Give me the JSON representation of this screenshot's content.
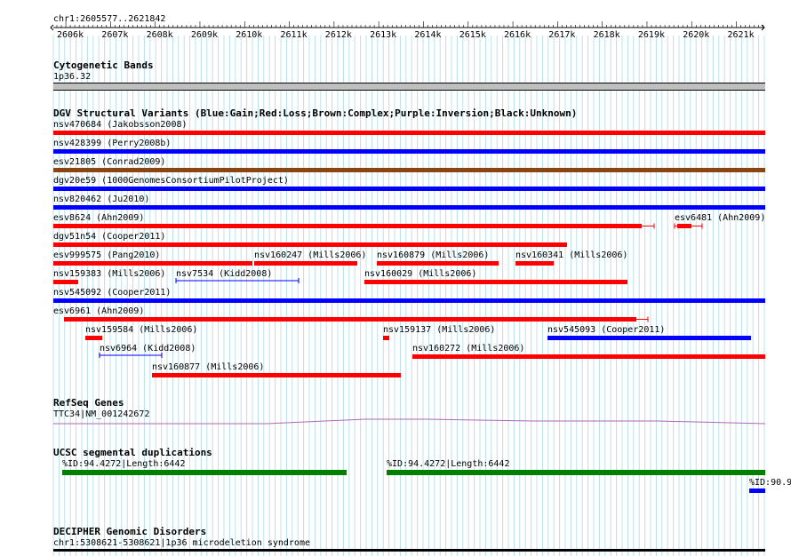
{
  "ruler": {
    "range_label": "chr1:2605577..2621842",
    "ticks": [
      "2606k",
      "2607k",
      "2608k",
      "2609k",
      "2610k",
      "2611k",
      "2612k",
      "2613k",
      "2614k",
      "2615k",
      "2616k",
      "2617k",
      "2618k",
      "2619k",
      "2620k",
      "2621k"
    ]
  },
  "cytoband": {
    "title": "Cytogenetic Bands",
    "label": "1p36.32"
  },
  "dgv": {
    "title": "DGV Structural Variants (Blue:Gain;Red:Loss;Brown:Complex;Purple:Inversion;Black:Unknown)",
    "colors": {
      "gain": "#0000ff",
      "loss": "#ff0000",
      "complex": "#8b4513",
      "unknown": "#000000"
    },
    "features": [
      {
        "name": "nsv470684 (Jakobsson2008)",
        "type": "loss"
      },
      {
        "name": "nsv428399 (Perry2008b)",
        "type": "gain"
      },
      {
        "name": "esv21805 (Conrad2009)",
        "type": "complex"
      },
      {
        "name": "dgv20e59 (1000GenomesConsortiumPilotProject)",
        "type": "gain"
      },
      {
        "name": "nsv820462 (Ju2010)",
        "type": "gain"
      },
      {
        "name": "esv8624 (Ahn2009)",
        "type": "loss"
      },
      {
        "name": "esv6481 (Ahn2009)",
        "type": "loss"
      },
      {
        "name": "dgv51n54 (Cooper2011)",
        "type": "loss"
      },
      {
        "name": "esv999575 (Pang2010)",
        "type": "loss"
      },
      {
        "name": "nsv160247 (Mills2006)",
        "type": "loss"
      },
      {
        "name": "nsv160879 (Mills2006)",
        "type": "loss"
      },
      {
        "name": "nsv160341 (Mills2006)",
        "type": "loss"
      },
      {
        "name": "nsv159383 (Mills2006)",
        "type": "loss"
      },
      {
        "name": "nsv7534 (Kidd2008)",
        "type": "gain"
      },
      {
        "name": "nsv160029 (Mills2006)",
        "type": "loss"
      },
      {
        "name": "nsv545092 (Cooper2011)",
        "type": "gain"
      },
      {
        "name": "esv6961 (Ahn2009)",
        "type": "loss"
      },
      {
        "name": "nsv159584 (Mills2006)",
        "type": "loss"
      },
      {
        "name": "nsv159137 (Mills2006)",
        "type": "loss"
      },
      {
        "name": "nsv545093 (Cooper2011)",
        "type": "gain"
      },
      {
        "name": "nsv6964 (Kidd2008)",
        "type": "gain"
      },
      {
        "name": "nsv160272 (Mills2006)",
        "type": "loss"
      },
      {
        "name": "nsv160877 (Mills2006)",
        "type": "loss"
      }
    ]
  },
  "refseq": {
    "title": "RefSeq Genes",
    "label": "TTC34|NM_001242672",
    "color": "#b366b3"
  },
  "segdups": {
    "title": "UCSC segmental duplications",
    "label_1": "%ID:94.4272|Length:6442",
    "label_2": "%ID:94.4272|Length:6442",
    "label_3": "%ID:90.9",
    "color_green": "#007f00",
    "color_blue": "#0000ff"
  },
  "decipher": {
    "title": "DECIPHER Genomic Disorders",
    "label": "chr1:5308621-5308621|1p36 microdeletion syndrome"
  }
}
